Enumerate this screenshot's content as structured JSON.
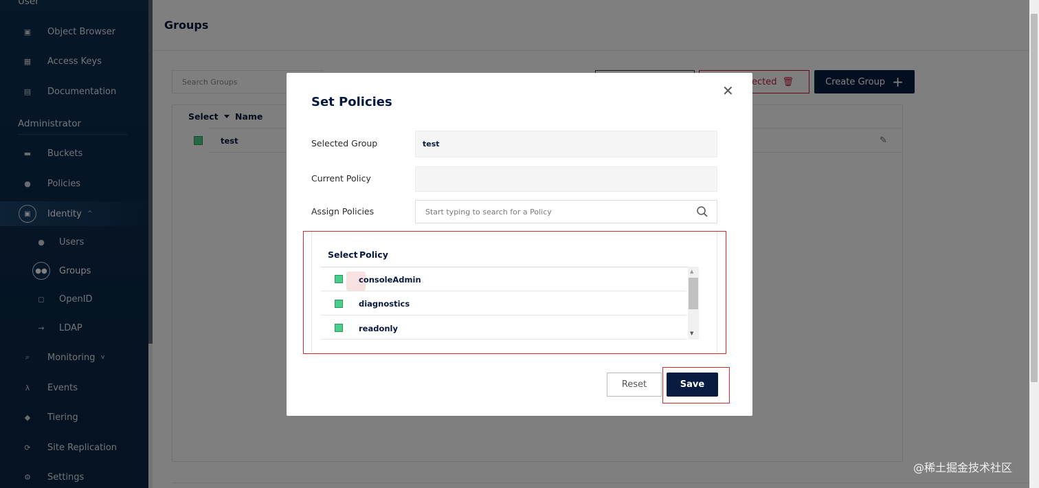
{
  "sidebar": {
    "section_user": "User",
    "items_user": [
      {
        "label": "Object Browser",
        "icon": "object-browser-icon"
      },
      {
        "label": "Access Keys",
        "icon": "key-icon"
      },
      {
        "label": "Documentation",
        "icon": "document-icon"
      }
    ],
    "section_admin": "Administrator",
    "items_admin": [
      {
        "label": "Buckets",
        "icon": "bucket-icon"
      },
      {
        "label": "Policies",
        "icon": "shield-icon"
      },
      {
        "label": "Identity",
        "icon": "identity-icon"
      },
      {
        "label": "Users",
        "icon": "user-icon"
      },
      {
        "label": "Groups",
        "icon": "groups-icon"
      },
      {
        "label": "OpenID",
        "icon": "lock-icon"
      },
      {
        "label": "LDAP",
        "icon": "login-icon"
      },
      {
        "label": "Monitoring",
        "icon": "monitoring-icon"
      },
      {
        "label": "Events",
        "icon": "lambda-icon"
      },
      {
        "label": "Tiering",
        "icon": "tiering-icon"
      },
      {
        "label": "Site Replication",
        "icon": "replication-icon"
      },
      {
        "label": "Settings",
        "icon": "gear-icon"
      }
    ]
  },
  "page": {
    "title": "Groups",
    "search_placeholder": "Search Groups",
    "delete_label": "elected",
    "create_label": "Create Group",
    "table": {
      "col_select": "Select",
      "col_name": "Name",
      "rows": [
        {
          "name": "test"
        }
      ]
    }
  },
  "modal": {
    "title": "Set Policies",
    "selected_group_label": "Selected Group",
    "selected_group_value": "test",
    "current_policy_label": "Current Policy",
    "current_policy_value": "",
    "assign_label": "Assign Policies",
    "assign_placeholder": "Start typing to search for a Policy",
    "policy_table": {
      "col_select": "Select",
      "col_policy": "Policy",
      "rows": [
        {
          "name": "consoleAdmin"
        },
        {
          "name": "diagnostics"
        },
        {
          "name": "readonly"
        }
      ]
    },
    "reset_label": "Reset",
    "save_label": "Save"
  },
  "colors": {
    "sidebar_bg": "#0b2a4a",
    "primary_button": "#081c42",
    "delete_red": "#c51b3c",
    "check_green": "#4cce8a",
    "highlight_red": "#d82c2c"
  },
  "watermark": "@稀土掘金技术社区"
}
